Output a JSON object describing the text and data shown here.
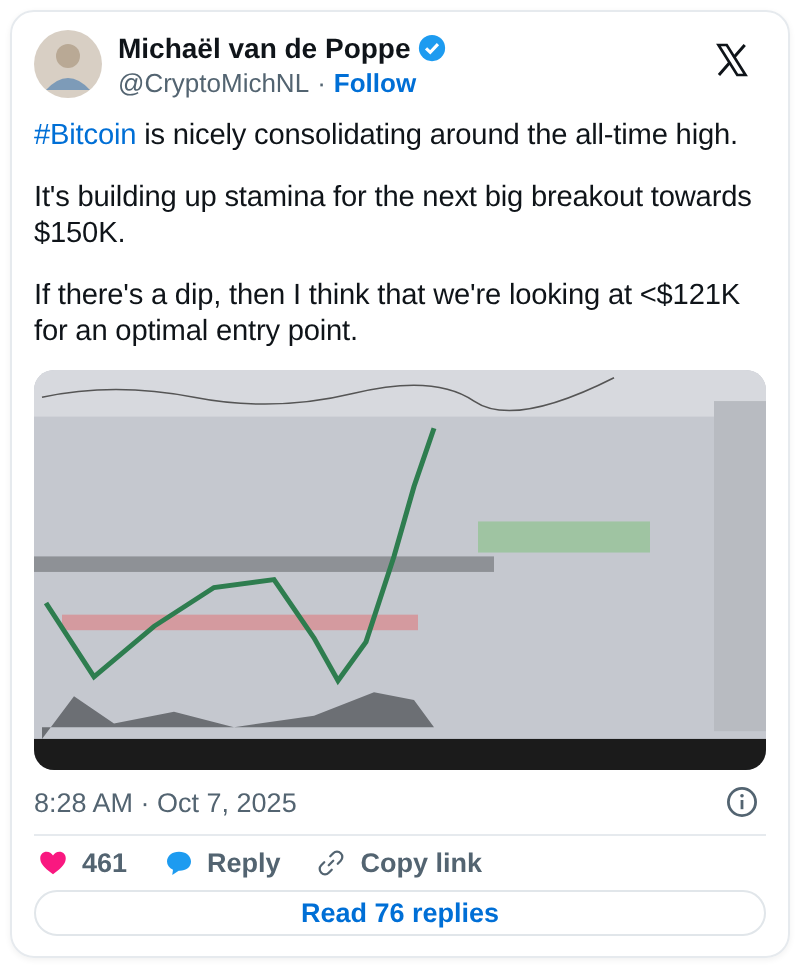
{
  "author": {
    "name": "Michaël van de Poppe",
    "verified": true,
    "handle": "@CryptoMichNL",
    "separator": "·",
    "follow": "Follow"
  },
  "paragraphs": [
    {
      "hashtag": "#Bitcoin",
      "text": " is nicely consolidating around the all-time high."
    },
    {
      "text": "It's building up stamina for the next big breakout towards $150K."
    },
    {
      "text": "If there's a dip, then I think that we're looking at <$121K for an optimal entry point."
    }
  ],
  "timestamp": "8:28 AM · Oct 7, 2025",
  "actions": [
    {
      "kind": "like",
      "label": "461"
    },
    {
      "kind": "reply",
      "label": "Reply"
    },
    {
      "kind": "copy",
      "label": "Copy link"
    }
  ],
  "read_replies": "Read 76 replies"
}
